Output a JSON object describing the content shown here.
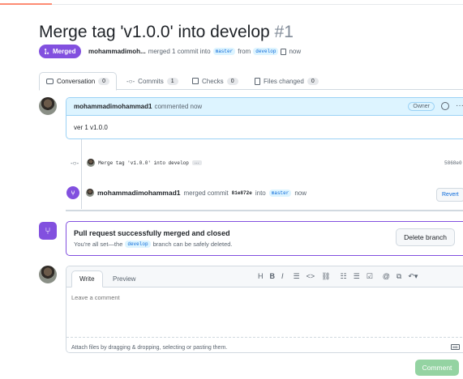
{
  "pr": {
    "title": "Merge tag 'v1.0.0' into develop",
    "number": "#1",
    "state_badge": "Merged",
    "author_truncated": "mohammadimoh...",
    "merge_text": "merged 1 commit into",
    "base_branch": "master",
    "from_text": "from",
    "head_branch": "develop",
    "time": "now"
  },
  "tabs": [
    {
      "label": "Conversation",
      "count": "0"
    },
    {
      "label": "Commits",
      "count": "1"
    },
    {
      "label": "Checks",
      "count": "0"
    },
    {
      "label": "Files changed",
      "count": "0"
    }
  ],
  "comment": {
    "author": "mohammadimohammad1",
    "action": "commented now",
    "role": "Owner",
    "body": "ver 1 v1.0.0"
  },
  "commit_event": {
    "message": "Merge tag 'v1.0.0' into develop",
    "ellipsis": "…",
    "sha": "5868e0"
  },
  "merge_event": {
    "author": "mohammadimohammad1",
    "action": "merged commit",
    "sha": "81e872e",
    "into": "into",
    "branch": "master",
    "time": "now",
    "revert_label": "Revert"
  },
  "merge_status": {
    "title": "Pull request successfully merged and closed",
    "sub_prefix": "You're all set—the",
    "branch": "develop",
    "sub_suffix": "branch can be safely deleted.",
    "delete_label": "Delete branch"
  },
  "editor": {
    "write_tab": "Write",
    "preview_tab": "Preview",
    "placeholder": "Leave a comment",
    "attach_text": "Attach files by dragging & dropping, selecting or pasting them.",
    "toolbar": {
      "heading": "H",
      "bold": "B",
      "italic": "I"
    },
    "md_badge": "MD"
  },
  "submit_label": "Comment",
  "colors": {
    "merged": "#8250df",
    "accent_blue": "#0969da",
    "comment_btn": "#94d3a2"
  }
}
